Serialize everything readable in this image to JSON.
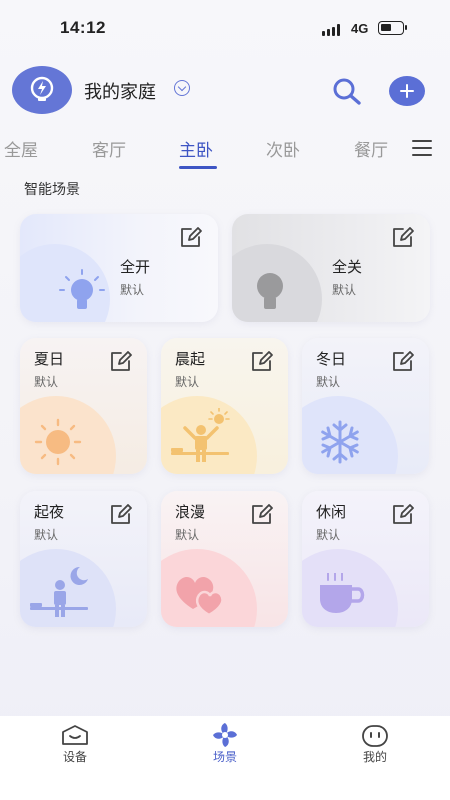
{
  "status_bar": {
    "time": "14:12",
    "network": "4G"
  },
  "header": {
    "home_name": "我的家庭"
  },
  "tabs": [
    {
      "label": "全屋"
    },
    {
      "label": "客厅"
    },
    {
      "label": "主卧",
      "active": true
    },
    {
      "label": "次卧"
    },
    {
      "label": "餐厅"
    }
  ],
  "section": {
    "title": "智能场景"
  },
  "scenes": [
    {
      "name": "全开",
      "sub": "默认",
      "icon": "bulb-on-icon"
    },
    {
      "name": "全关",
      "sub": "默认",
      "icon": "bulb-off-icon"
    },
    {
      "name": "夏日",
      "sub": "默认",
      "icon": "sun-icon"
    },
    {
      "name": "晨起",
      "sub": "默认",
      "icon": "morning-stretch-icon"
    },
    {
      "name": "冬日",
      "sub": "默认",
      "icon": "snowflake-icon"
    },
    {
      "name": "起夜",
      "sub": "默认",
      "icon": "night-moon-icon"
    },
    {
      "name": "浪漫",
      "sub": "默认",
      "icon": "hearts-icon"
    },
    {
      "name": "休闲",
      "sub": "默认",
      "icon": "coffee-cup-icon"
    }
  ],
  "bottom_nav": [
    {
      "label": "设备",
      "icon": "device-icon"
    },
    {
      "label": "场景",
      "icon": "scene-pinwheel-icon",
      "active": true
    },
    {
      "label": "我的",
      "icon": "profile-icon"
    }
  ],
  "colors": {
    "accent": "#3e55c4",
    "brand": "#6476d6"
  }
}
